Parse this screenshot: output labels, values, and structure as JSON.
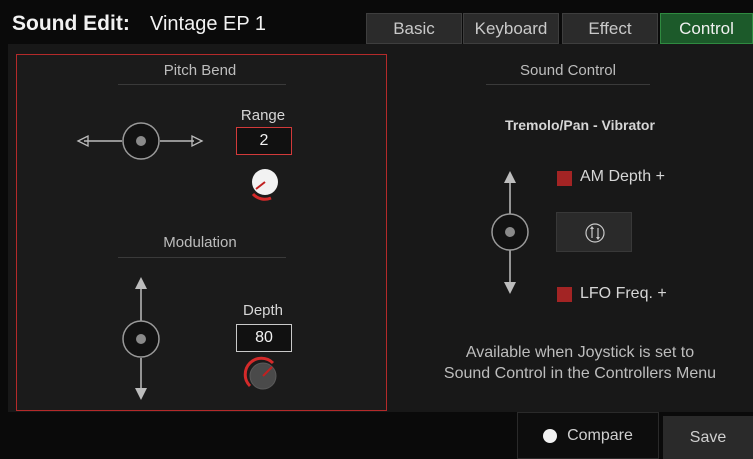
{
  "header": {
    "title_label": "Sound Edit:",
    "sound_name": "Vintage EP 1",
    "tabs": [
      "Basic",
      "Keyboard",
      "Effect",
      "Control"
    ],
    "active_tab": "Control"
  },
  "pitch_bend": {
    "title": "Pitch Bend",
    "range_label": "Range",
    "range_value": "2"
  },
  "modulation": {
    "title": "Modulation",
    "depth_label": "Depth",
    "depth_value": "80"
  },
  "sound_control": {
    "title": "Sound Control",
    "subtitle": "Tremolo/Pan - Vibrator",
    "am_depth_label": "AM Depth +",
    "lfo_freq_label": "LFO Freq. +",
    "info_line1": "Available when Joystick is set to",
    "info_line2": "Sound Control in the Controllers Menu"
  },
  "footer": {
    "compare_label": "Compare",
    "save_label": "Save"
  },
  "colors": {
    "accent_red": "#b42a2a",
    "active_tab_green": "#1c5a2a"
  }
}
